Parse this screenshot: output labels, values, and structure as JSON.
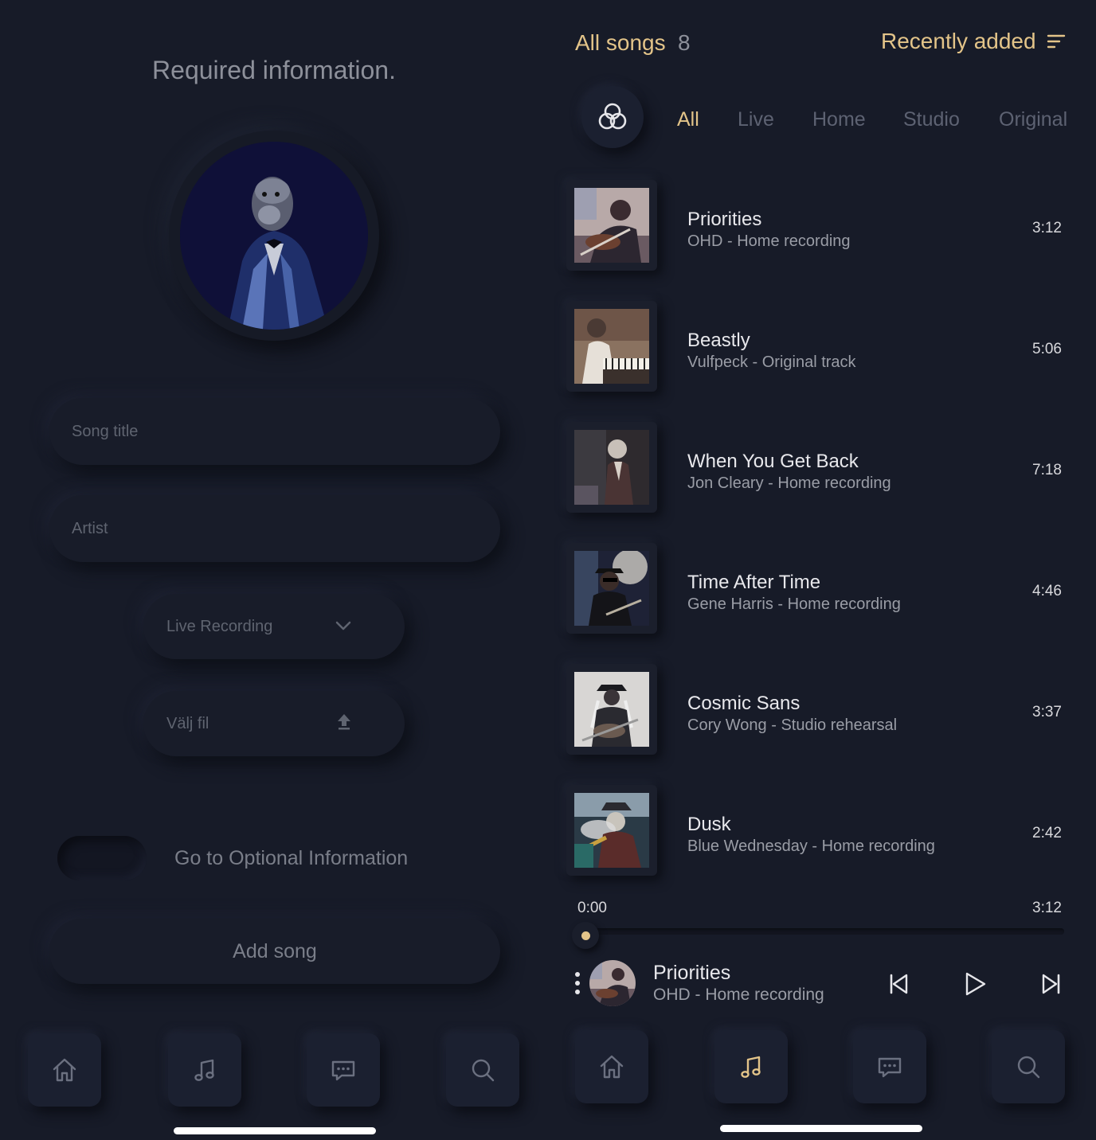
{
  "left": {
    "title": "Required information.",
    "fields": {
      "song_title_placeholder": "Song title",
      "artist_placeholder": "Artist",
      "recording_type": "Live Recording",
      "file_label": "Välj fil"
    },
    "toggle_label": "Go to Optional Information",
    "add_button": "Add song",
    "nav": [
      "home-icon",
      "music-note-icon",
      "chat-icon",
      "search-icon"
    ]
  },
  "right": {
    "header": {
      "title": "All songs",
      "count": "8",
      "sort_label": "Recently added"
    },
    "tabs": [
      {
        "label": "All",
        "active": true
      },
      {
        "label": "Live",
        "active": false
      },
      {
        "label": "Home",
        "active": false
      },
      {
        "label": "Studio",
        "active": false
      },
      {
        "label": "Original",
        "active": false
      }
    ],
    "songs": [
      {
        "title": "Priorities",
        "subtitle": "OHD - Home recording",
        "duration": "3:12"
      },
      {
        "title": "Beastly",
        "subtitle": "Vulfpeck - Original track",
        "duration": "5:06"
      },
      {
        "title": "When You Get Back",
        "subtitle": "Jon Cleary - Home recording",
        "duration": "7:18"
      },
      {
        "title": "Time After Time",
        "subtitle": "Gene Harris - Home recording",
        "duration": "4:46"
      },
      {
        "title": "Cosmic Sans",
        "subtitle": "Cory Wong - Studio rehearsal",
        "duration": "3:37"
      },
      {
        "title": "Dusk",
        "subtitle": "Blue Wednesday - Home recording",
        "duration": "2:42"
      }
    ],
    "player": {
      "elapsed": "0:00",
      "total": "3:12",
      "progress": 0,
      "title": "Priorities",
      "subtitle": "OHD - Home recording"
    },
    "nav": [
      "home-icon",
      "music-note-icon",
      "chat-icon",
      "search-icon"
    ],
    "nav_active": "music-note-icon"
  },
  "colors": {
    "accent": "#e3c489",
    "background": "#171b28",
    "muted": "#5d6272"
  }
}
